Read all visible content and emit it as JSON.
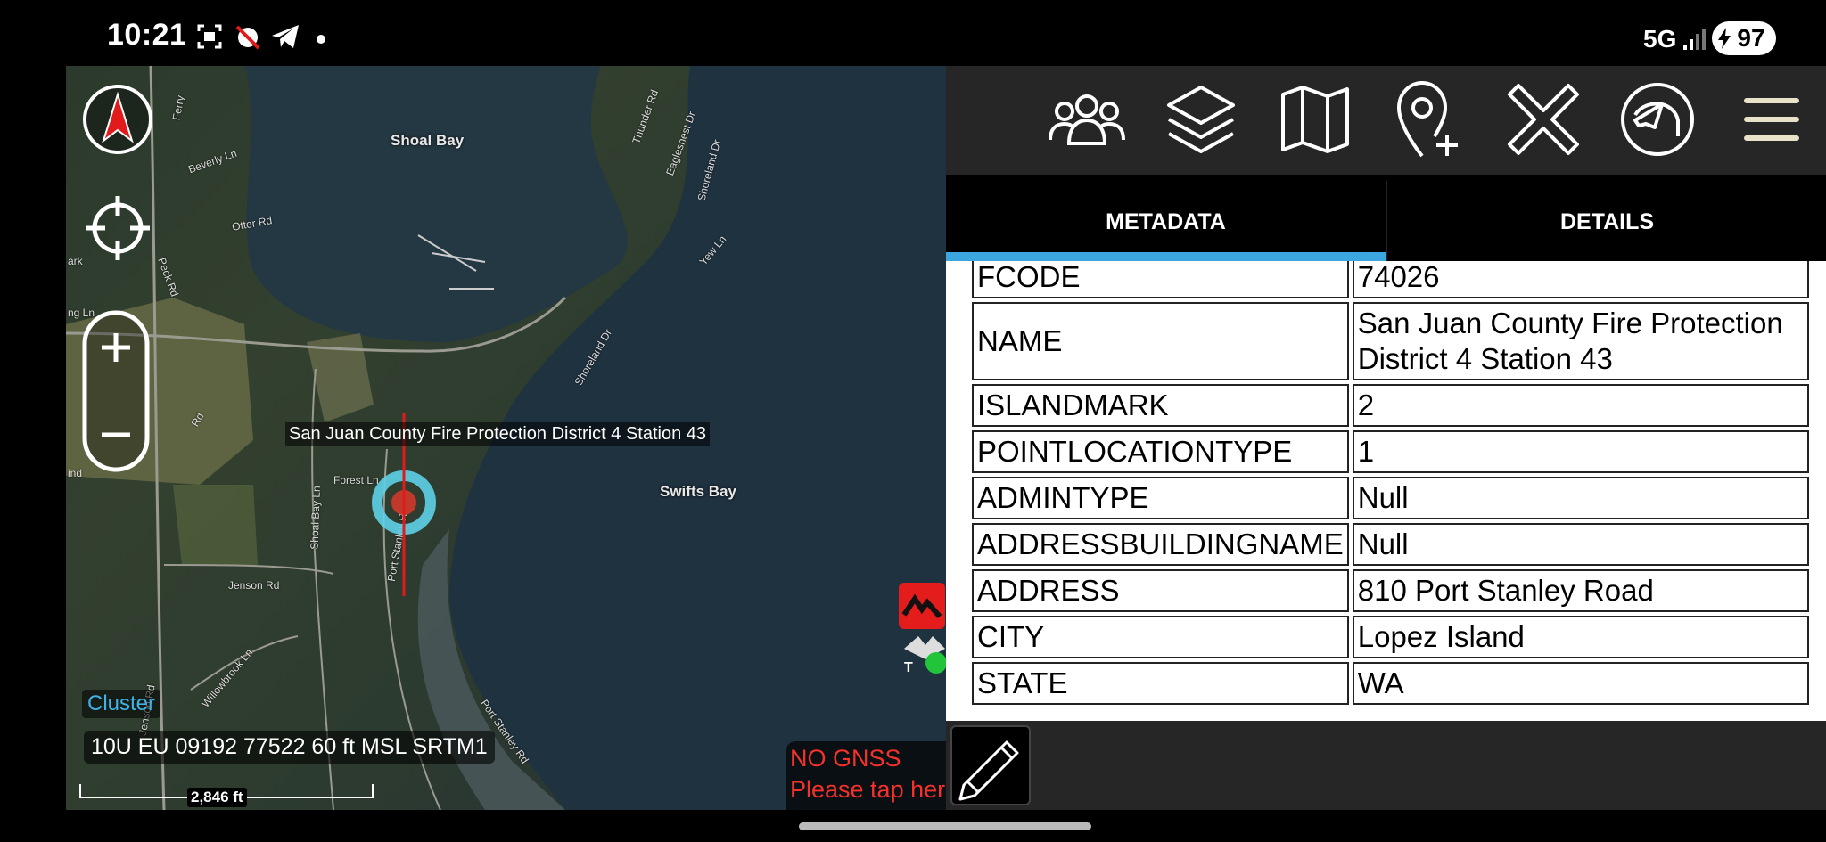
{
  "status_bar": {
    "time": "10:21",
    "network": "5G",
    "battery": "97"
  },
  "map": {
    "places": [
      "Shoal Bay",
      "Swifts Bay"
    ],
    "roads": [
      "Ferry",
      "Beverly Ln",
      "Otter Rd",
      "Peck Rd",
      "Thunder Rd",
      "Eaglesnest Dr",
      "Shoreland Dr",
      "Yew Ln",
      "Shoreland Dr",
      "Forest Ln",
      "Port Stanley Rd",
      "Shoal Bay Ln",
      "Jenson Rd",
      "Jenson Rd",
      "Willowbrook Ln",
      "Port Stanley Rd",
      "ark",
      "ng Ln",
      "ind",
      "Rd"
    ],
    "site_label": "San Juan County Fire Protection District 4 Station 43",
    "cluster_label": "Cluster",
    "coordinates": "10U EU 09192 77522 60 ft MSL SRTM1",
    "scale": "2,846 ft",
    "gnss_warning_title": "NO GNSS",
    "gnss_warning_body": "Please tap here to set your location manually",
    "colors": {
      "warning": "#f4312b",
      "cluster": "#3fb2e6",
      "crosshair": "#e11b1b",
      "target_ring": "#5fd0e8"
    }
  },
  "toolbar": {
    "icons": [
      "contacts-icon",
      "layers-icon",
      "map-icon",
      "add-marker-icon",
      "close-icon",
      "dog-icon",
      "menu-icon"
    ]
  },
  "tabs": {
    "metadata": "METADATA",
    "details": "DETAILS",
    "active": "METADATA",
    "accent": "#3ba6e0"
  },
  "metadata_rows": [
    {
      "key": "FCODE",
      "value": "74026"
    },
    {
      "key": "NAME",
      "value": "San Juan County Fire Protection District 4 Station 43"
    },
    {
      "key": "ISLANDMARK",
      "value": "2"
    },
    {
      "key": "POINTLOCATIONTYPE",
      "value": "1"
    },
    {
      "key": "ADMINTYPE",
      "value": "Null"
    },
    {
      "key": "ADDRESSBUILDINGNAME",
      "value": "Null"
    },
    {
      "key": "ADDRESS",
      "value": "810 Port Stanley Road"
    },
    {
      "key": "CITY",
      "value": "Lopez Island"
    },
    {
      "key": "STATE",
      "value": "WA"
    }
  ]
}
